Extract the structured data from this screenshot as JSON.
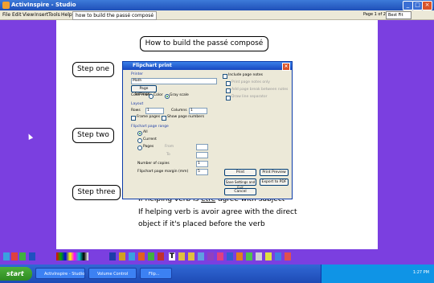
{
  "window": {
    "title": "ActivInspire - Studio"
  },
  "menu": {
    "items": [
      "File",
      "Edit",
      "View",
      "Insert",
      "Tools",
      "Help"
    ],
    "tab": "how to build the passé composé",
    "page_label": "Page 1 of 2",
    "zoom": "Best Fit"
  },
  "flipchart": {
    "heading": "How to build the passé composé",
    "steps": [
      "Step one",
      "Step two",
      "Step three"
    ],
    "body_line1_pre": "If helping verb is ",
    "body_line1_ul": "être",
    "body_line1_post": " agree with subject",
    "body_line2": "If helping verb is avoir agree with the direct",
    "body_line3": "object if it's placed before the verb"
  },
  "dialog": {
    "title": "Flipchart print",
    "printer_section": "Printer",
    "printer_value": "Math",
    "page_settings": "Page Settings...",
    "color_mode_label": "Color mode",
    "color": "Color",
    "gray_scale": "Gray scale",
    "layout_section": "Layout",
    "rows_label": "Rows",
    "rows_value": "1",
    "columns_label": "Columns",
    "columns_value": "1",
    "frame_pages": "Frame pages",
    "show_page_numbers": "Show page numbers",
    "range_section": "Flipchart page range",
    "all": "All",
    "current": "Current",
    "pages": "Pages",
    "from": "From",
    "to": "To",
    "copies_label": "Number of copies",
    "copies_value": "1",
    "margin_label": "Flipchart page margin (mm)",
    "margin_value": "5",
    "include_notes": "Include page notes",
    "print_notes_only": "Print page notes only",
    "add_page_break": "Add page break between notes",
    "draw_separator": "Draw line separator",
    "print_btn": "Print",
    "print_preview_btn": "Print Preview",
    "save_exit_btn": "Save Settings and Exit",
    "export_pdf_btn": "Export to PDF",
    "cancel_btn": "Cancel"
  },
  "taskbar": {
    "start": "start",
    "tasks": [
      "ActivInspire - Studio",
      "Volume Control",
      "Flip..."
    ],
    "clock": "1:27 PM"
  },
  "colors": {
    "desktop": "#7b3fe0",
    "titlebar": "#1f4fb8",
    "dialog_bg": "#ece9d8",
    "start": "#2e8b22"
  }
}
